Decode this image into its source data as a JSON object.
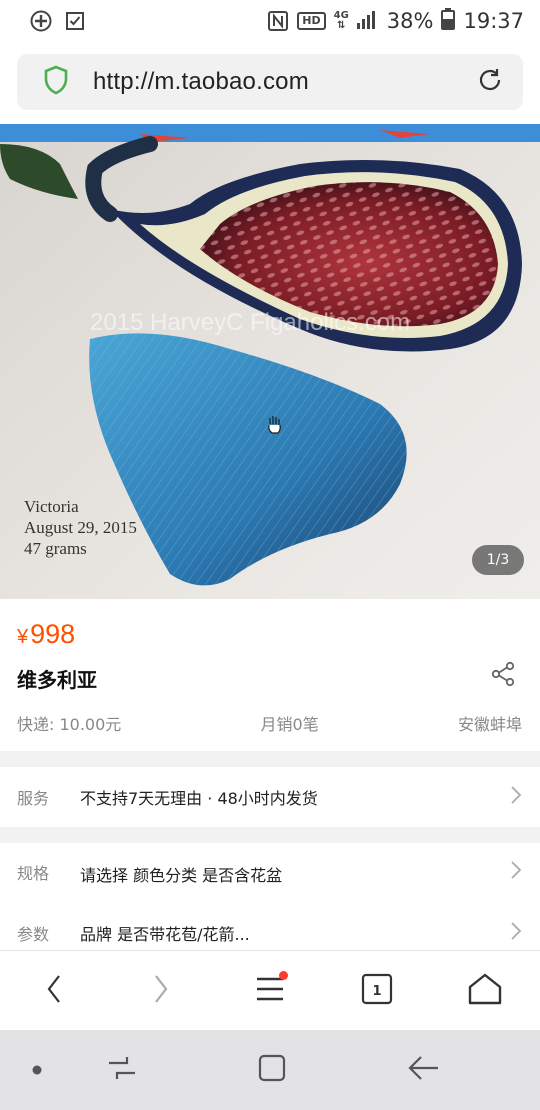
{
  "status_bar": {
    "battery": "38%",
    "time": "19:37",
    "network": "4G",
    "hd_label": "HD"
  },
  "address_bar": {
    "url": "http://m.taobao.com"
  },
  "product_image": {
    "watermark": "2015 HarveyC  Figaholics.com",
    "caption_lines": [
      "Victoria",
      "August 29, 2015",
      "47 grams"
    ],
    "counter": "1/3"
  },
  "product": {
    "currency": "¥",
    "price": "998",
    "title": "维多利亚",
    "shipping": "快递: 10.00元",
    "monthly_sales": "月销0笔",
    "location": "安徽蚌埠"
  },
  "service": {
    "label": "服务",
    "text": "不支持7天无理由 · 48小时内发货"
  },
  "specs": [
    {
      "label": "规格",
      "text": "请选择 颜色分类 是否含花盆"
    },
    {
      "label": "参数",
      "text": "品牌 是否带花苞/花箭..."
    }
  ],
  "toolbar": {
    "tab_count": "1"
  },
  "icons": [
    "add-circle-icon",
    "checkbox-icon",
    "nfc-icon",
    "signal-icon",
    "battery-icon",
    "shield-icon",
    "reload-icon",
    "share-icon",
    "chevron-right-icon",
    "back-icon",
    "forward-icon",
    "menu-icon",
    "tabs-icon",
    "home-icon",
    "recent-apps-icon",
    "android-home-icon",
    "android-back-icon"
  ],
  "colors": {
    "price": "#ff5000",
    "shield": "#4caf50",
    "notification_dot": "#ff3b30"
  }
}
